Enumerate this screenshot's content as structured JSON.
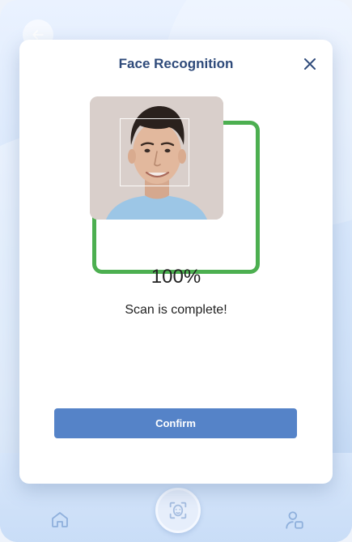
{
  "modal": {
    "title": "Face Recognition",
    "progress_text": "100%",
    "status_text": "Scan is complete!",
    "confirm_label": "Confirm"
  },
  "icons": {
    "back": "arrow-left-icon",
    "close": "close-icon",
    "home": "home-icon",
    "face_scan": "face-scan-icon",
    "profile": "user-settings-icon"
  },
  "colors": {
    "accent": "#5583c8",
    "title": "#2e4a7a",
    "success": "#4caf50"
  }
}
